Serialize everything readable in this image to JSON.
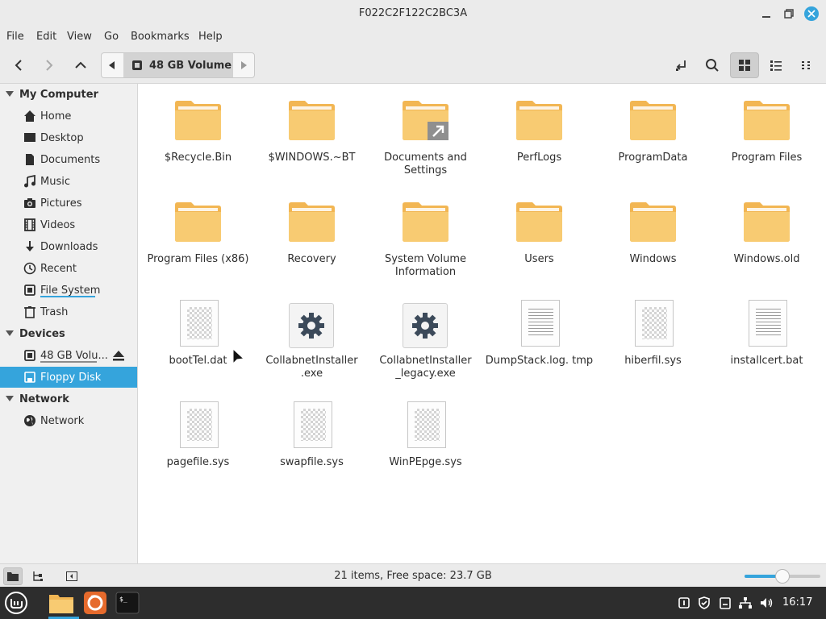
{
  "window": {
    "title": "F022C2F122C2BC3A"
  },
  "menu": [
    "File",
    "Edit",
    "View",
    "Go",
    "Bookmarks",
    "Help"
  ],
  "toolbar": {
    "location": "48 GB Volume"
  },
  "sidebar": {
    "sections": [
      {
        "title": "My Computer",
        "items": [
          {
            "label": "Home",
            "icon": "home-icon"
          },
          {
            "label": "Desktop",
            "icon": "desktop-icon"
          },
          {
            "label": "Documents",
            "icon": "documents-icon"
          },
          {
            "label": "Music",
            "icon": "music-icon"
          },
          {
            "label": "Pictures",
            "icon": "pictures-icon"
          },
          {
            "label": "Videos",
            "icon": "videos-icon"
          },
          {
            "label": "Downloads",
            "icon": "downloads-icon"
          },
          {
            "label": "Recent",
            "icon": "recent-icon"
          },
          {
            "label": "File System",
            "icon": "drive-icon"
          },
          {
            "label": "Trash",
            "icon": "trash-icon"
          }
        ]
      },
      {
        "title": "Devices",
        "items": [
          {
            "label": "48 GB Volu...",
            "icon": "drive-icon"
          },
          {
            "label": "Floppy Disk",
            "icon": "floppy-icon"
          }
        ]
      },
      {
        "title": "Network",
        "items": [
          {
            "label": "Network",
            "icon": "network-icon"
          }
        ]
      }
    ]
  },
  "files": [
    {
      "name": "$Recycle.Bin",
      "type": "folder"
    },
    {
      "name": "$WINDOWS.~BT",
      "type": "folder"
    },
    {
      "name": "Documents and Settings",
      "type": "folder-link"
    },
    {
      "name": "PerfLogs",
      "type": "folder"
    },
    {
      "name": "ProgramData",
      "type": "folder"
    },
    {
      "name": "Program Files",
      "type": "folder"
    },
    {
      "name": "Program Files (x86)",
      "type": "folder"
    },
    {
      "name": "Recovery",
      "type": "folder"
    },
    {
      "name": "System Volume Information",
      "type": "folder"
    },
    {
      "name": "Users",
      "type": "folder"
    },
    {
      "name": "Windows",
      "type": "folder"
    },
    {
      "name": "Windows.old",
      "type": "folder"
    },
    {
      "name": "bootTel.dat",
      "type": "binary"
    },
    {
      "name": "CollabnetInstaller .exe",
      "type": "exe"
    },
    {
      "name": "CollabnetInstaller _legacy.exe",
      "type": "exe"
    },
    {
      "name": "DumpStack.log. tmp",
      "type": "text"
    },
    {
      "name": "hiberfil.sys",
      "type": "binary"
    },
    {
      "name": "installcert.bat",
      "type": "text"
    },
    {
      "name": "pagefile.sys",
      "type": "binary"
    },
    {
      "name": "swapfile.sys",
      "type": "binary"
    },
    {
      "name": "WinPEpge.sys",
      "type": "binary"
    }
  ],
  "status": {
    "text": "21 items, Free space: 23.7 GB",
    "zoom_level": 0.5
  },
  "taskbar": {
    "clock": "16:17"
  },
  "colors": {
    "accent": "#35a4dc",
    "folder": "#f6c86b",
    "folder_tab": "#f2b653",
    "taskbar": "#2d2d2d"
  }
}
